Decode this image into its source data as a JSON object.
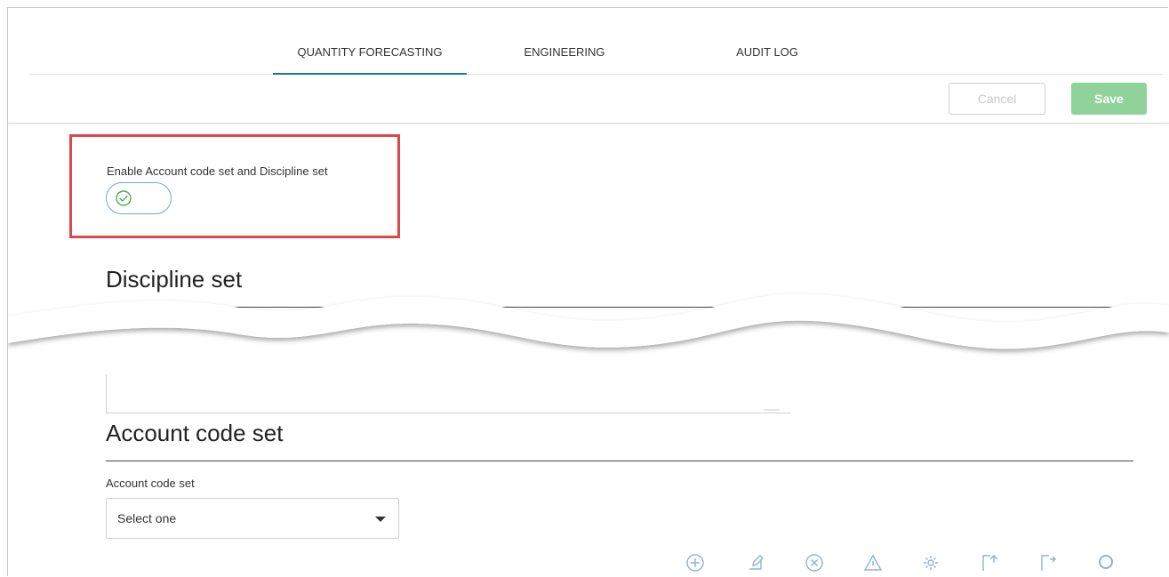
{
  "tabs": [
    {
      "label": "QUANTITY FORECASTING",
      "active": true
    },
    {
      "label": "ENGINEERING",
      "active": false
    },
    {
      "label": "AUDIT LOG",
      "active": false
    }
  ],
  "toolbar": {
    "cancel_label": "Cancel",
    "save_label": "Save"
  },
  "enable_setting": {
    "label": "Enable Account code set and Discipline set",
    "toggle_icon": "check-circle-icon",
    "enabled": true
  },
  "discipline": {
    "title": "Discipline set"
  },
  "account": {
    "title": "Account code set",
    "field_label": "Account code set",
    "select_value": "Select one"
  },
  "toolbar_icons": [
    "add-circle-icon",
    "edit-icon",
    "remove-circle-icon",
    "warning-icon",
    "settings-icon",
    "import-icon",
    "export-icon",
    "search-icon"
  ],
  "colors": {
    "tab_underline": "#1f6fb8",
    "save_button": "#8fd39a",
    "highlight_border": "#e0474c",
    "toggle_border": "#68a9d6",
    "check_icon": "#4caf50",
    "toolbar_icon": "#8fb3d6"
  }
}
